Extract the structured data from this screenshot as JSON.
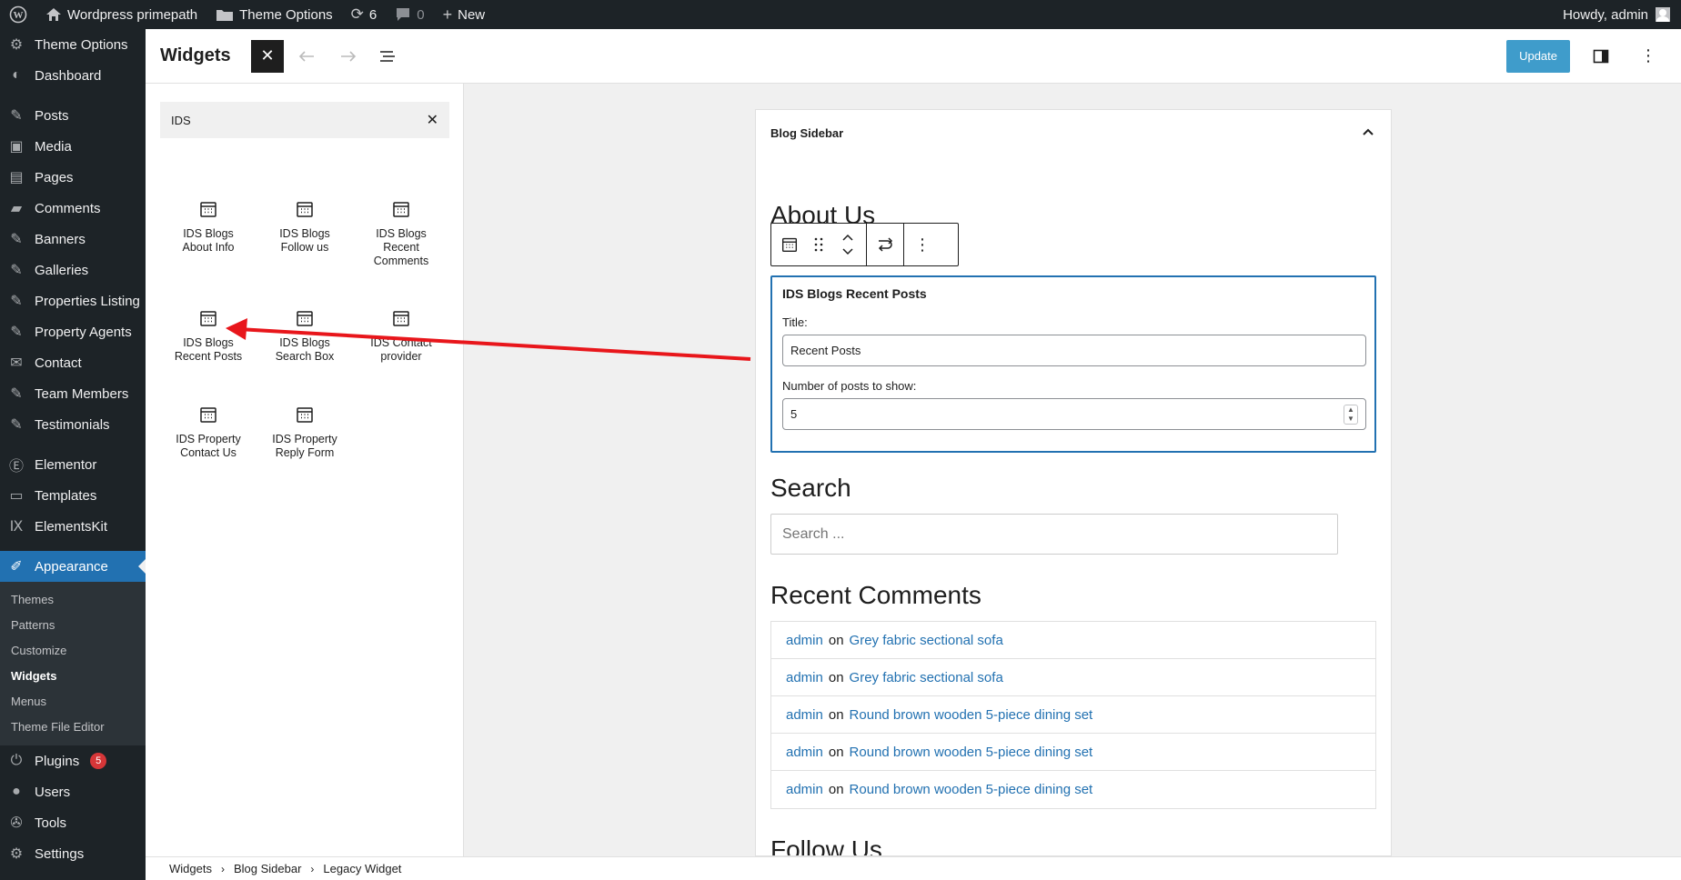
{
  "adminbar": {
    "site_name": "Wordpress primepath",
    "theme_options": "Theme Options",
    "updates_count": "6",
    "comments_count": "0",
    "new_label": "New",
    "howdy": "Howdy, admin"
  },
  "menu": {
    "theme_options": "Theme Options",
    "dashboard": "Dashboard",
    "posts": "Posts",
    "media": "Media",
    "pages": "Pages",
    "comments": "Comments",
    "banners": "Banners",
    "galleries": "Galleries",
    "properties_listing": "Properties Listing",
    "property_agents": "Property Agents",
    "contact": "Contact",
    "team_members": "Team Members",
    "testimonials": "Testimonials",
    "elementor": "Elementor",
    "templates": "Templates",
    "elementskit": "ElementsKit",
    "appearance": "Appearance",
    "sub_themes": "Themes",
    "sub_patterns": "Patterns",
    "sub_customize": "Customize",
    "sub_widgets": "Widgets",
    "sub_menus": "Menus",
    "sub_theme_file_editor": "Theme File Editor",
    "plugins": "Plugins",
    "plugins_badge": "5",
    "users": "Users",
    "tools": "Tools",
    "settings": "Settings"
  },
  "header": {
    "title": "Widgets",
    "update_label": "Update"
  },
  "inserter": {
    "search_value": "IDS",
    "blocks": [
      {
        "line1": "IDS Blogs",
        "line2": "About Info",
        "line3": ""
      },
      {
        "line1": "IDS Blogs",
        "line2": "Follow us",
        "line3": ""
      },
      {
        "line1": "IDS Blogs",
        "line2": "Recent",
        "line3": "Comments"
      },
      {
        "line1": "IDS Blogs",
        "line2": "Recent Posts",
        "line3": ""
      },
      {
        "line1": "IDS Blogs",
        "line2": "Search Box",
        "line3": ""
      },
      {
        "line1": "IDS Contact",
        "line2": "provider",
        "line3": ""
      },
      {
        "line1": "IDS Property",
        "line2": "Contact Us",
        "line3": ""
      },
      {
        "line1": "IDS Property",
        "line2": "Reply Form",
        "line3": ""
      }
    ]
  },
  "canvas": {
    "area_title": "Blog Sidebar",
    "about_heading": "About Us",
    "widget": {
      "title": "IDS Blogs Recent Posts",
      "title_label": "Title:",
      "title_value": "Recent Posts",
      "count_label": "Number of posts to show:",
      "count_value": "5"
    },
    "search_heading": "Search",
    "search_placeholder": "Search ...",
    "recent_comments_heading": "Recent Comments",
    "comments": [
      {
        "author": "admin",
        "on": "on",
        "post": "Grey fabric sectional sofa"
      },
      {
        "author": "admin",
        "on": "on",
        "post": "Grey fabric sectional sofa"
      },
      {
        "author": "admin",
        "on": "on",
        "post": "Round brown wooden 5-piece dining set"
      },
      {
        "author": "admin",
        "on": "on",
        "post": "Round brown wooden 5-piece dining set"
      },
      {
        "author": "admin",
        "on": "on",
        "post": "Round brown wooden 5-piece dining set"
      }
    ],
    "follow_heading": "Follow Us"
  },
  "breadcrumb": {
    "items": [
      "Widgets",
      "Blog Sidebar",
      "Legacy Widget"
    ]
  }
}
